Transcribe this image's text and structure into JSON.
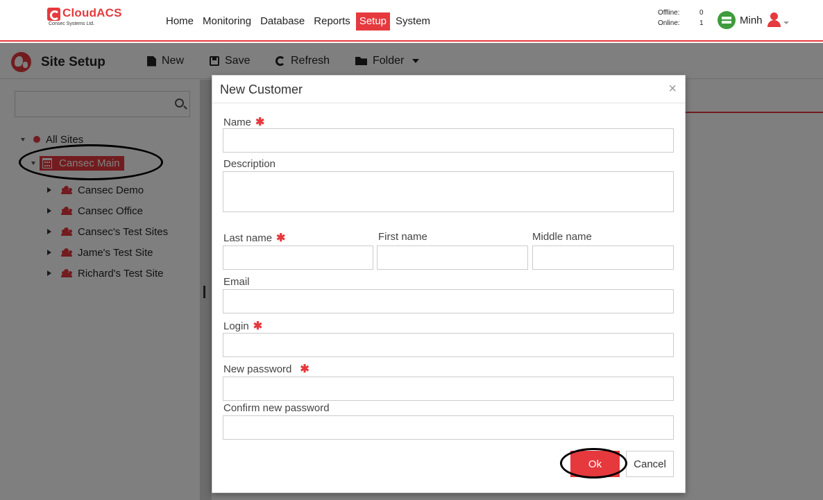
{
  "header": {
    "brand": "CloudACS",
    "tagline": "Consec Systems Ltd.",
    "nav": [
      "Home",
      "Monitoring",
      "Database",
      "Reports",
      "Setup",
      "System"
    ],
    "active_nav": "Setup",
    "status": {
      "offline_label": "Offline:",
      "offline_value": "0",
      "online_label": "Online:",
      "online_value": "1"
    },
    "user_name": "Minh"
  },
  "toolbar": {
    "title": "Site Setup",
    "new_label": "New",
    "save_label": "Save",
    "refresh_label": "Refresh",
    "folder_label": "Folder"
  },
  "tree": {
    "root": "All Sites",
    "selected": "Cansec Main",
    "children": [
      "Cansec Demo",
      "Cansec Office",
      "Cansec's Test Sites",
      "Jame's Test Site",
      "Richard's Test Site"
    ]
  },
  "dialog": {
    "title": "New Customer",
    "close": "×",
    "labels": {
      "name": "Name",
      "description": "Description",
      "last_name": "Last name",
      "first_name": "First name",
      "middle_name": "Middle name",
      "email": "Email",
      "login": "Login",
      "new_password": "New password",
      "confirm_password": "Confirm new password"
    },
    "required_mark": "✱",
    "ok_label": "Ok",
    "cancel_label": "Cancel"
  },
  "colors": {
    "accent": "#e5393e",
    "online_badge": "#3e9c3c"
  }
}
